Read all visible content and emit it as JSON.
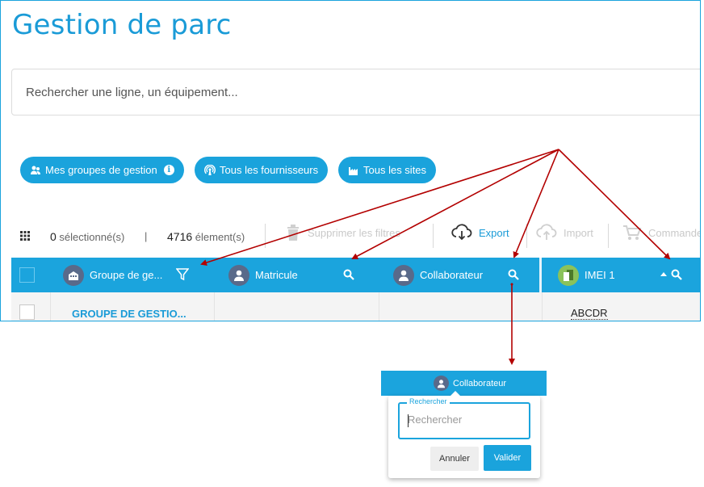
{
  "page": {
    "title": "Gestion de parc"
  },
  "search": {
    "placeholder": "Rechercher une ligne, un équipement..."
  },
  "filters": [
    {
      "label": "Mes groupes de gestion",
      "icon": "users-icon",
      "info": "i"
    },
    {
      "label": "Tous les fournisseurs",
      "icon": "antenna-icon"
    },
    {
      "label": "Tous les sites",
      "icon": "factory-icon"
    }
  ],
  "toolbar": {
    "selected_count": "0",
    "selected_label": "sélectionné(s)",
    "separator": "|",
    "total_count": "4716",
    "total_label": "élement(s)",
    "delete_filters": "Supprimer les filtres",
    "export": "Export",
    "import": "Import",
    "order": "Commande"
  },
  "table": {
    "columns": [
      {
        "label": "Groupe de ge...",
        "action_icon": "filter-icon"
      },
      {
        "label": "Matricule",
        "action_icon": "search-icon"
      },
      {
        "label": "Collaborateur",
        "action_icon": "search-icon"
      },
      {
        "label": "IMEI 1",
        "action_icon": "sort-up-search-icon"
      }
    ],
    "rows": [
      {
        "group": "GROUPE DE GESTIO...",
        "matricule": "",
        "collaborateur": "",
        "imei": "ABCDR"
      }
    ]
  },
  "popup": {
    "header": "Collaborateur",
    "legend": "Rechercher",
    "placeholder": "Rechercher",
    "cancel": "Annuler",
    "validate": "Valider"
  },
  "colors": {
    "accent": "#1ba4dd",
    "arrow": "#b30000",
    "avatar": "#596a8a"
  }
}
